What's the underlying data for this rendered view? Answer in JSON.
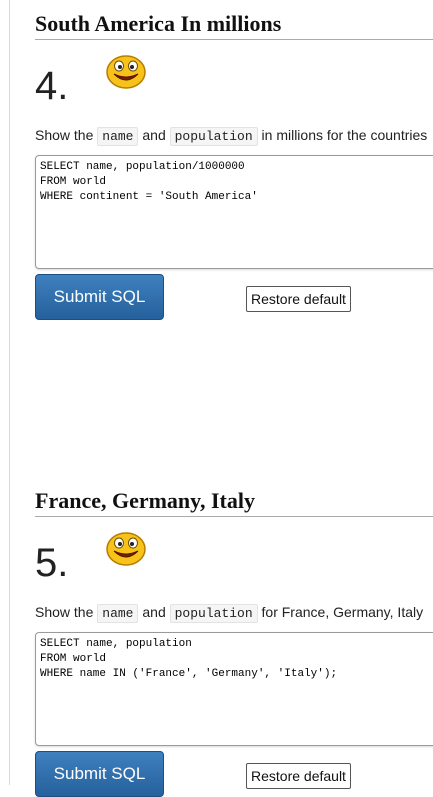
{
  "questions": [
    {
      "title": "South America In millions",
      "number": "4.",
      "prompt": {
        "pre": "Show the",
        "code1": "name",
        "mid": "and",
        "code2": "population",
        "post": "in millions for the countries"
      },
      "sql": "SELECT name, population/1000000\nFROM world\nWHERE continent = 'South America'",
      "submit_label": "Submit SQL",
      "restore_label": "Restore default"
    },
    {
      "title": "France, Germany, Italy",
      "number": "5.",
      "prompt": {
        "pre": "Show the",
        "code1": "name",
        "mid": "and",
        "code2": "population",
        "post": "for France, Germany, Italy"
      },
      "sql": "SELECT name, population\nFROM world\nWHERE name IN ('France', 'Germany', 'Italy');",
      "submit_label": "Submit SQL",
      "restore_label": "Restore default"
    }
  ],
  "icons": {
    "smiley": "smiley-face-icon"
  },
  "colors": {
    "submit_button": "#2f6fae",
    "smiley_yellow": "#f7c21a"
  }
}
